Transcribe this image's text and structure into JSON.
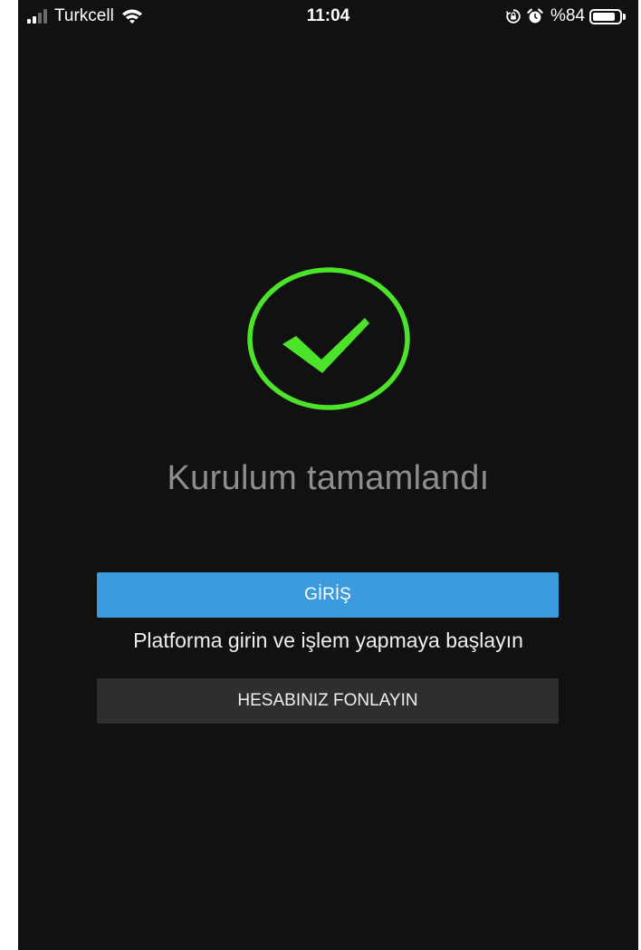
{
  "status_bar": {
    "carrier": "Turkcell",
    "time": "11:04",
    "battery_text": "%84",
    "battery_level": 0.84,
    "signal_bars_filled": 2,
    "signal_bars_total": 4,
    "icons": [
      "signal-icon",
      "wifi-icon",
      "orientation-lock-icon",
      "alarm-icon",
      "battery-icon"
    ]
  },
  "main": {
    "success_icon": "checkmark-circle-icon",
    "title": "Kurulum tamamlandı",
    "login_button_label": "GİRİŞ",
    "subtitle": "Platforma girin ve işlem yapmaya başlayın",
    "fund_button_label": "HESABINIZ FONLAYIN"
  },
  "colors": {
    "background": "#111111",
    "accent_blue": "#3b9bdd",
    "success_green": "#4ce32b",
    "secondary_button": "#2e2e2e",
    "title_gray": "#8e8e8e"
  }
}
